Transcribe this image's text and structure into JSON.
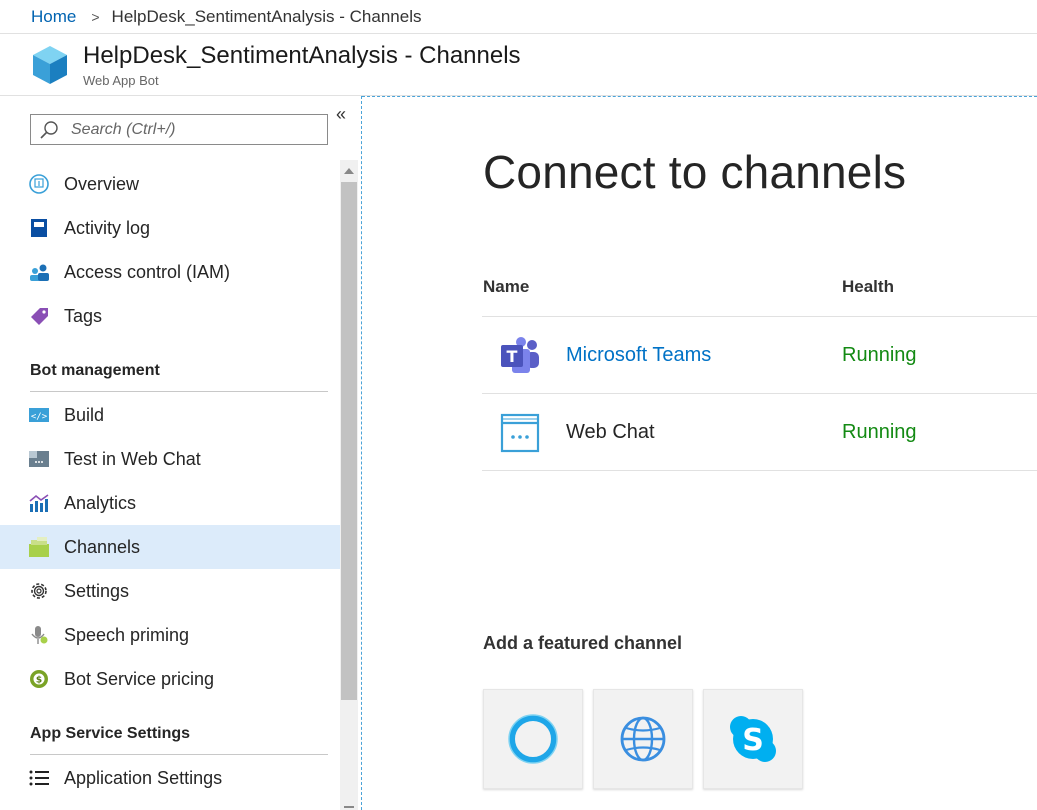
{
  "breadcrumb": {
    "home": "Home",
    "separator": ">",
    "current": "HelpDesk_SentimentAnalysis - Channels"
  },
  "header": {
    "title": "HelpDesk_SentimentAnalysis - Channels",
    "subtitle": "Web App Bot",
    "icon": "cube-icon"
  },
  "sidebar": {
    "search_placeholder": "Search (Ctrl+/)",
    "collapse_glyph": "«",
    "items": [
      {
        "label": "Overview",
        "icon": "overview-icon"
      },
      {
        "label": "Activity log",
        "icon": "activity-log-icon"
      },
      {
        "label": "Access control (IAM)",
        "icon": "iam-icon"
      },
      {
        "label": "Tags",
        "icon": "tag-icon"
      }
    ],
    "sections": [
      {
        "title": "Bot management",
        "items": [
          {
            "label": "Build",
            "icon": "code-icon"
          },
          {
            "label": "Test in Web Chat",
            "icon": "webchat-test-icon"
          },
          {
            "label": "Analytics",
            "icon": "analytics-icon"
          },
          {
            "label": "Channels",
            "icon": "channels-icon",
            "active": true
          },
          {
            "label": "Settings",
            "icon": "gear-icon"
          },
          {
            "label": "Speech priming",
            "icon": "microphone-icon"
          },
          {
            "label": "Bot Service pricing",
            "icon": "pricing-icon"
          }
        ]
      },
      {
        "title": "App Service Settings",
        "items": [
          {
            "label": "Application Settings",
            "icon": "list-icon"
          }
        ]
      }
    ]
  },
  "main": {
    "heading": "Connect to channels",
    "table": {
      "columns": [
        "Name",
        "Health"
      ],
      "rows": [
        {
          "name": "Microsoft Teams",
          "health": "Running",
          "icon": "teams-icon",
          "link": true
        },
        {
          "name": "Web Chat",
          "health": "Running",
          "icon": "webchat-icon",
          "link": false
        }
      ]
    },
    "featured_title": "Add a featured channel",
    "featured": [
      {
        "icon": "cortana-icon"
      },
      {
        "icon": "globe-icon"
      },
      {
        "icon": "skype-icon"
      }
    ]
  },
  "colors": {
    "accent": "#0072c6",
    "running": "#138a13",
    "active_bg": "#dcebfa"
  }
}
